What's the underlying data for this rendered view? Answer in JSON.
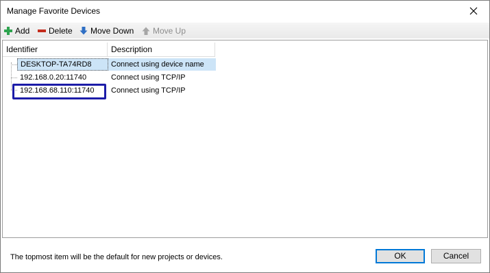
{
  "window": {
    "title": "Manage Favorite Devices"
  },
  "toolbar": {
    "add_label": "Add",
    "delete_label": "Delete",
    "move_down_label": "Move Down",
    "move_up_label": "Move Up",
    "move_up_enabled": false
  },
  "list": {
    "columns": [
      "Identifier",
      "Description"
    ],
    "rows": [
      {
        "identifier": "DESKTOP-TA74RD8",
        "description": "Connect using device name",
        "selected": true
      },
      {
        "identifier": "192.168.0.20:11740",
        "description": "Connect using TCP/IP",
        "selected": false
      },
      {
        "identifier": "192.168.68.110:11740",
        "description": "Connect using TCP/IP",
        "selected": false,
        "highlighted": true
      }
    ]
  },
  "footer": {
    "note": "The topmost item will be the default for new projects or devices.",
    "ok_label": "OK",
    "cancel_label": "Cancel"
  },
  "colors": {
    "selection": "#cce4f7",
    "highlight_box": "#1c1ca8",
    "add_icon": "#2ea44f",
    "delete_icon": "#c42b1c",
    "move_down_icon": "#2f6fc4",
    "default_button_border": "#0078d7"
  },
  "icons": {
    "add": "plus-icon",
    "delete": "minus-icon",
    "move_down": "arrow-down-icon",
    "move_up": "arrow-up-icon",
    "close": "close-icon"
  }
}
